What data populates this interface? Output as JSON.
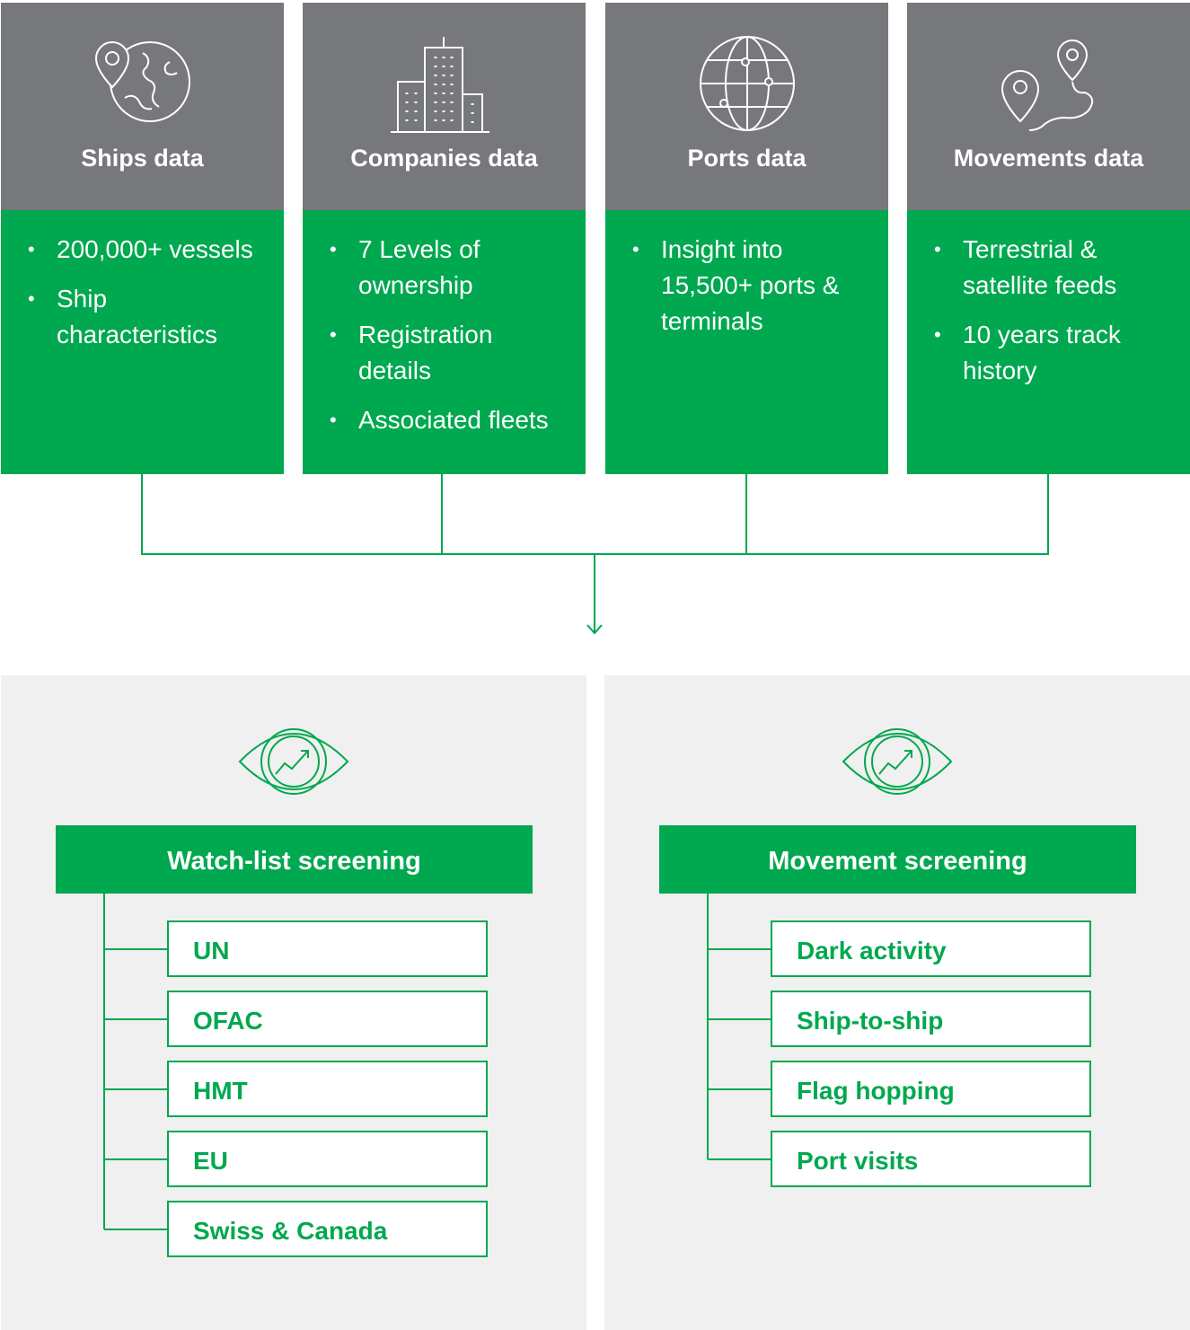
{
  "sources": [
    {
      "title": "Ships data",
      "icon": "globe-pin-icon",
      "bullets": [
        "200,000+ vessels",
        "Ship characteristics"
      ]
    },
    {
      "title": "Companies data",
      "icon": "buildings-icon",
      "bullets": [
        "7 Levels of ownership",
        "Registration details",
        "Associated fleets"
      ]
    },
    {
      "title": "Ports data",
      "icon": "network-globe-icon",
      "bullets": [
        "Insight into 15,500+ ports & terminals"
      ]
    },
    {
      "title": "Movements data",
      "icon": "route-pins-icon",
      "bullets": [
        "Terrestrial & satellite feeds",
        "10 years track history"
      ]
    }
  ],
  "screenings": [
    {
      "title": "Watch-list screening",
      "icon": "eye-chart-icon",
      "items": [
        "UN",
        "OFAC",
        "HMT",
        "EU",
        "Swiss & Canada"
      ]
    },
    {
      "title": "Movement screening",
      "icon": "eye-chart-icon",
      "items": [
        "Dark activity",
        "Ship-to-ship",
        "Flag hopping",
        "Port visits"
      ]
    }
  ],
  "colors": {
    "green": "#00a84f",
    "gray": "#77787b",
    "panel": "#f0f0f0"
  }
}
